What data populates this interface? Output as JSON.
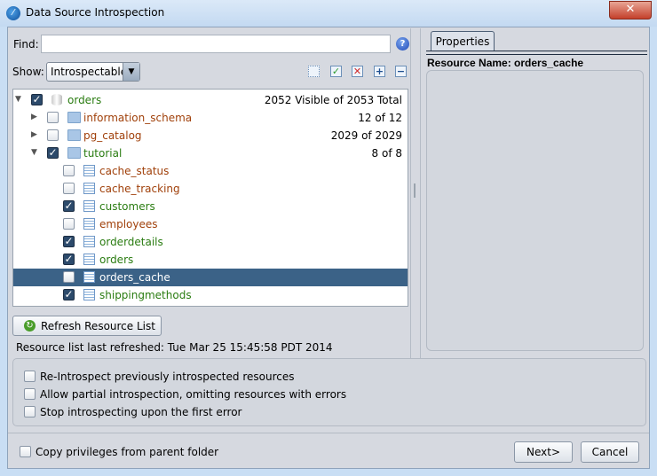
{
  "window": {
    "title": "Data Source Introspection",
    "close": "✕"
  },
  "find": {
    "label": "Find:",
    "value": "",
    "help": "?"
  },
  "show": {
    "label": "Show:",
    "value": "Introspectable"
  },
  "tree": [
    {
      "name": "orders",
      "count": "2052 Visible of 2053 Total",
      "checked": true,
      "level": 0,
      "type": "db",
      "expanded": true,
      "color": "g"
    },
    {
      "name": "information_schema",
      "count": "12 of 12",
      "checked": false,
      "level": 1,
      "type": "folder",
      "expanded": false,
      "color": "b"
    },
    {
      "name": "pg_catalog",
      "count": "2029 of 2029",
      "checked": false,
      "level": 1,
      "type": "folder",
      "expanded": false,
      "color": "b"
    },
    {
      "name": "tutorial",
      "count": "8 of 8",
      "checked": true,
      "level": 1,
      "type": "folder",
      "expanded": true,
      "color": "g"
    },
    {
      "name": "cache_status",
      "count": "",
      "checked": false,
      "level": 2,
      "type": "table",
      "color": "b"
    },
    {
      "name": "cache_tracking",
      "count": "",
      "checked": false,
      "level": 2,
      "type": "table",
      "color": "b"
    },
    {
      "name": "customers",
      "count": "",
      "checked": true,
      "level": 2,
      "type": "table",
      "color": "g"
    },
    {
      "name": "employees",
      "count": "",
      "checked": false,
      "level": 2,
      "type": "table",
      "color": "b"
    },
    {
      "name": "orderdetails",
      "count": "",
      "checked": true,
      "level": 2,
      "type": "table",
      "color": "g"
    },
    {
      "name": "orders",
      "count": "",
      "checked": true,
      "level": 2,
      "type": "table",
      "color": "g"
    },
    {
      "name": "orders_cache",
      "count": "",
      "checked": false,
      "level": 2,
      "type": "table",
      "color": "b",
      "selected": true
    },
    {
      "name": "shippingmethods",
      "count": "",
      "checked": true,
      "level": 2,
      "type": "table",
      "color": "g"
    }
  ],
  "refresh": {
    "label": "Refresh Resource List",
    "status": "Resource list last refreshed: Tue Mar 25 15:45:58 PDT 2014"
  },
  "properties": {
    "tab": "Properties",
    "resource_name": "Resource Name: orders_cache"
  },
  "options": [
    "Re-Introspect previously introspected resources",
    "Allow partial introspection, omitting resources with errors",
    "Stop introspecting upon the first error"
  ],
  "footer": {
    "copy_privileges": "Copy privileges from parent folder",
    "next": "Next>",
    "cancel": "Cancel"
  }
}
